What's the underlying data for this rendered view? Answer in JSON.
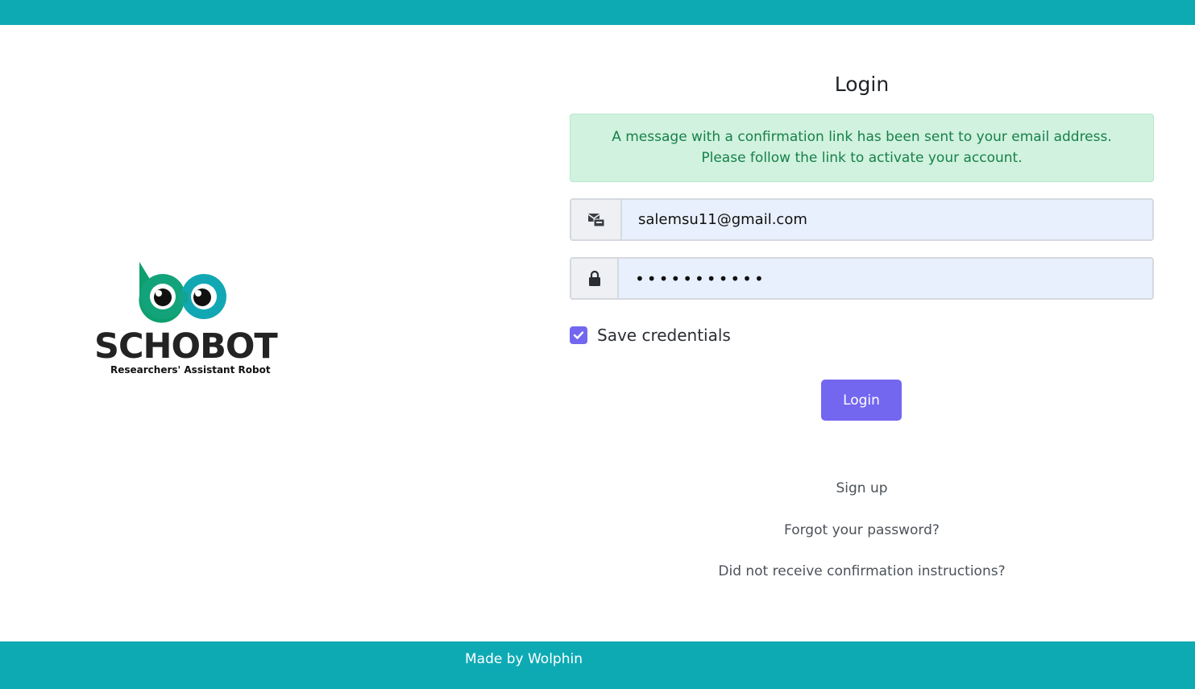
{
  "header": {},
  "logo": {
    "name": "SCHOBOT",
    "tagline": "Researchers' Assistant Robot"
  },
  "form": {
    "title": "Login",
    "alert_message": "A message with a confirmation link has been sent to your email address. Please follow the link to activate your account.",
    "email_value": "salemsu11@gmail.com",
    "email_icon": "envelope-icon",
    "password_value": "•••••••••••",
    "password_icon": "lock-icon",
    "save_credentials_label": "Save credentials",
    "save_credentials_checked": true,
    "login_button": "Login"
  },
  "links": {
    "sign_up": "Sign up",
    "forgot_password": "Forgot your password?",
    "no_confirmation": "Did not receive confirmation instructions?"
  },
  "footer": {
    "text": "Made by Wolphin"
  },
  "colors": {
    "brand_teal": "#0eaab4",
    "accent_purple": "#7367f0",
    "alert_bg": "#d1f2df",
    "alert_text": "#17804a"
  }
}
